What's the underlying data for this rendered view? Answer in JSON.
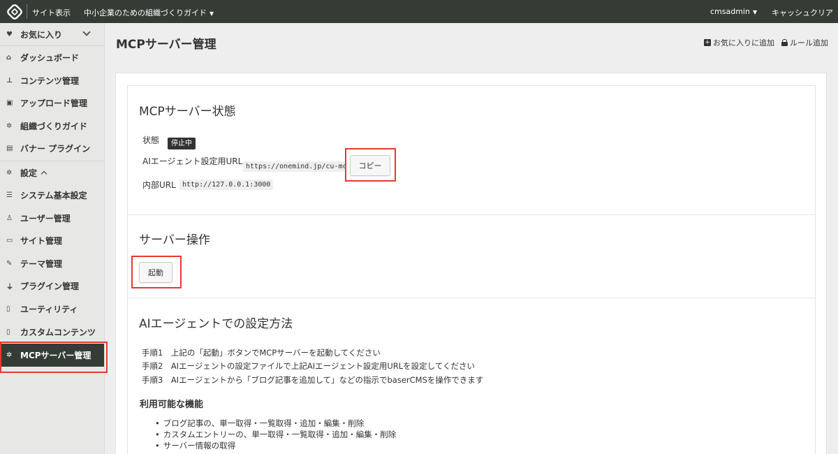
{
  "topbar": {
    "site_view": "サイト表示",
    "site_name": "中小企業のための組織づくりガイド",
    "user": "cmsadmin",
    "cache_clear": "キャッシュクリア"
  },
  "sidebar": {
    "favorites": "お気に入り",
    "items": [
      {
        "label": "ダッシュボード",
        "icon": "home-icon"
      },
      {
        "label": "コンテンツ管理",
        "icon": "sitemap-icon"
      },
      {
        "label": "アップロード管理",
        "icon": "image-icon"
      },
      {
        "label": "組織づくりガイド",
        "icon": "gear-icon"
      },
      {
        "label": "バナー プラグイン",
        "icon": "file-icon"
      }
    ],
    "settings": "設定",
    "settings_items": [
      {
        "label": "システム基本設定",
        "icon": "list-icon"
      },
      {
        "label": "ユーザー管理",
        "icon": "user-icon"
      },
      {
        "label": "サイト管理",
        "icon": "id-card-icon"
      },
      {
        "label": "テーマ管理",
        "icon": "brush-icon"
      },
      {
        "label": "プラグイン管理",
        "icon": "plug-icon"
      },
      {
        "label": "ユーティリティ",
        "icon": "file-icon"
      },
      {
        "label": "カスタムコンテンツ",
        "icon": "file-icon"
      },
      {
        "label": "MCPサーバー管理",
        "icon": "gear-icon",
        "active": true
      }
    ]
  },
  "header": {
    "title": "MCPサーバー管理",
    "add_favorite": "お気に入りに追加",
    "add_rule": "ルール追加"
  },
  "status_section": {
    "title": "MCPサーバー状態",
    "status_label": "状態",
    "status_value": "停止中",
    "ai_url_label": "AIエージェント設定用URL",
    "ai_url_value": "https://onemind.jp/cu-mcp",
    "copy_button": "コピー",
    "internal_url_label": "内部URL",
    "internal_url_value": "http://127.0.0.1:3000"
  },
  "operation_section": {
    "title": "サーバー操作",
    "start_button": "起動"
  },
  "howto_section": {
    "title": "AIエージェントでの設定方法",
    "steps": [
      "手順1　上記の「起動」ボタンでMCPサーバーを起動してください",
      "手順2　AIエージェントの設定ファイルで上記AIエージェント設定用URLを設定してください",
      "手順3　AIエージェントから「ブログ記事を追加して」などの指示でbaserCMSを操作できます"
    ],
    "features_title": "利用可能な機能",
    "features": [
      "ブログ記事の、単一取得・一覧取得・追加・編集・削除",
      "カスタムエントリーの、単一取得・一覧取得・追加・編集・削除",
      "サーバー情報の取得"
    ]
  },
  "colors": {
    "topbar": "#353c35",
    "sidebar": "#e7e8e6",
    "highlight": "#e53a2f"
  }
}
